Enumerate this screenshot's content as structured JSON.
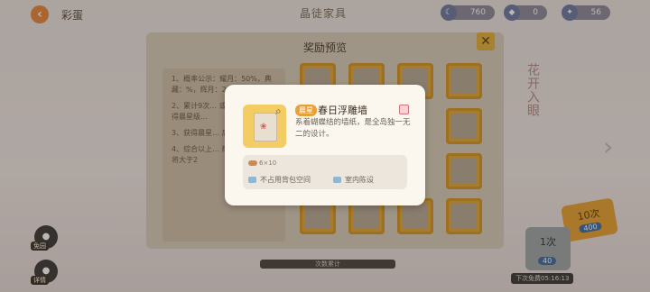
{
  "topbar": {
    "back_label": "彩蛋",
    "tab_title": "晶徒家具",
    "currencies": [
      {
        "value": "760",
        "icon": "moon-coin-icon"
      },
      {
        "value": "0",
        "icon": "gem-icon"
      },
      {
        "value": "56",
        "icon": "star-coin-icon"
      }
    ]
  },
  "side": {
    "btn1_label": "免园",
    "btn2_label": "详情"
  },
  "panel": {
    "title": "奖励预览",
    "rules": [
      "1、概率公示：耀月：50%，典藏：%，辉月：2",
      "2、累计9次… 或以上物品… 获得晨星级…",
      "3、获得晨星… 后，上一级的…",
      "4、综合以上… 辉月的最终概率将大于2"
    ]
  },
  "draws": {
    "ten_label": "10次",
    "ten_cost": "400",
    "one_label": "1次",
    "one_cost": "40",
    "timer": "下次免费05:16:13"
  },
  "bottom_info": "次数累计",
  "right_vert_text": "花开入眼",
  "item": {
    "rarity": "晨星",
    "name": "春日浮雕墙",
    "desc": "系着蝴蝶结的墙纸，是全岛独一无二的设计。",
    "qty": "6×10",
    "prop1": "不占用背包空间",
    "prop2": "室内陈设"
  }
}
